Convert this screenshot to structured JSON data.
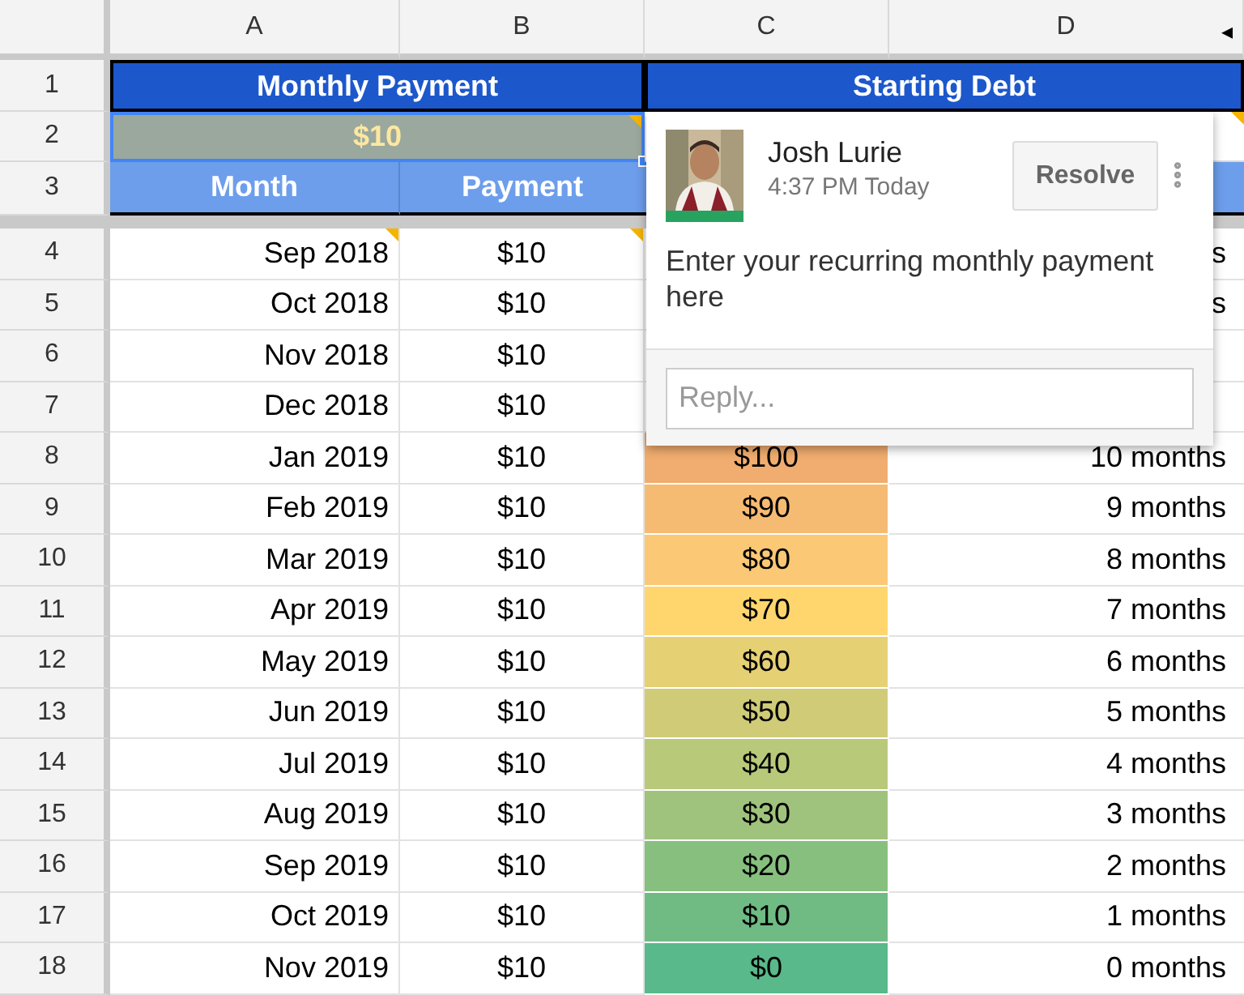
{
  "columns": [
    "A",
    "B",
    "C",
    "D"
  ],
  "scroll_arrow": "◂",
  "header_rows": [
    "1",
    "2",
    "3"
  ],
  "header": {
    "title_left": "Monthly Payment",
    "title_right": "Starting Debt",
    "right_note": true,
    "payment": {
      "value": "$10",
      "selected": true,
      "note": true
    },
    "col_month": "Month",
    "col_payment": "Payment"
  },
  "rows": [
    {
      "number": "4",
      "month": "Sep 2018",
      "payment": "$10",
      "month_note": true,
      "payment_note": true,
      "remaining": "s"
    },
    {
      "number": "5",
      "month": "Oct 2018",
      "payment": "$10",
      "month_note": false,
      "payment_note": false,
      "remaining": "s"
    },
    {
      "number": "6",
      "month": "Nov 2018",
      "payment": "$10",
      "month_note": false,
      "payment_note": false
    },
    {
      "number": "7",
      "month": "Dec 2018",
      "payment": "$10",
      "month_note": false,
      "payment_note": false
    },
    {
      "number": "8",
      "month": "Jan 2019",
      "payment": "$10",
      "month_note": false,
      "payment_note": false,
      "debt": "$100",
      "color": "#f1ad6f",
      "remaining": "10 months"
    },
    {
      "number": "9",
      "month": "Feb 2019",
      "payment": "$10",
      "month_note": false,
      "payment_note": false,
      "debt": "$90",
      "color": "#f6bb72",
      "remaining": "9 months"
    },
    {
      "number": "10",
      "month": "Mar 2019",
      "payment": "$10",
      "month_note": false,
      "payment_note": false,
      "debt": "$80",
      "color": "#fbc875",
      "remaining": "8 months"
    },
    {
      "number": "11",
      "month": "Apr 2019",
      "payment": "$10",
      "month_note": false,
      "payment_note": false,
      "debt": "$70",
      "color": "#ffd66e",
      "remaining": "7 months"
    },
    {
      "number": "12",
      "month": "May 2019",
      "payment": "$10",
      "month_note": false,
      "payment_note": false,
      "debt": "$60",
      "color": "#e6d074",
      "remaining": "6 months"
    },
    {
      "number": "13",
      "month": "Jun 2019",
      "payment": "$10",
      "month_note": false,
      "payment_note": false,
      "debt": "$50",
      "color": "#d0cb77",
      "remaining": "5 months"
    },
    {
      "number": "14",
      "month": "Jul 2019",
      "payment": "$10",
      "month_note": false,
      "payment_note": false,
      "debt": "$40",
      "color": "#b8c97a",
      "remaining": "4 months"
    },
    {
      "number": "15",
      "month": "Aug 2019",
      "payment": "$10",
      "month_note": false,
      "payment_note": false,
      "debt": "$30",
      "color": "#9fc37c",
      "remaining": "3 months"
    },
    {
      "number": "16",
      "month": "Sep 2019",
      "payment": "$10",
      "month_note": false,
      "payment_note": false,
      "debt": "$20",
      "color": "#87bf7f",
      "remaining": "2 months"
    },
    {
      "number": "17",
      "month": "Oct 2019",
      "payment": "$10",
      "month_note": false,
      "payment_note": false,
      "debt": "$10",
      "color": "#70bb83",
      "remaining": "1 months"
    },
    {
      "number": "18",
      "month": "Nov 2019",
      "payment": "$10",
      "month_note": false,
      "payment_note": false,
      "debt": "$0",
      "color": "#59b98a",
      "remaining": "0 months"
    }
  ],
  "comment": {
    "author": "Josh Lurie",
    "time": "4:37 PM Today",
    "resolve": "Resolve",
    "text": "Enter your recurring monthly payment here",
    "reply_placeholder": "Reply..."
  }
}
